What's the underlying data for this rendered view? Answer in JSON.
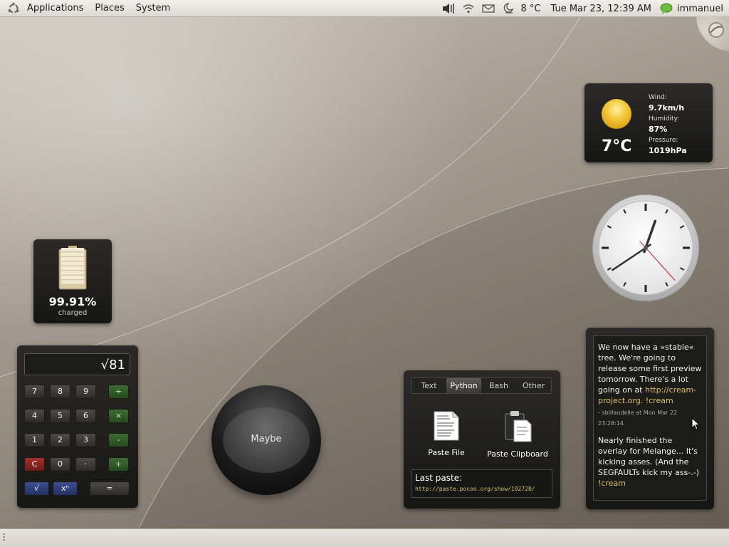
{
  "top_panel": {
    "menus": [
      "Applications",
      "Places",
      "System"
    ],
    "weather_text": "8 °C",
    "datetime": "Tue Mar 23, 12:39 AM",
    "username": "immanuel",
    "icons": [
      "ubuntu-logo-icon",
      "volume-icon",
      "wifi-icon",
      "mail-icon",
      "weather-night-icon",
      "chat-status-icon"
    ]
  },
  "weather": {
    "temperature": "7°C",
    "wind_label": "Wind:",
    "wind_value": "9.7km/h",
    "humidity_label": "Humidity:",
    "humidity_value": "87%",
    "pressure_label": "Pressure:",
    "pressure_value": "1019hPa",
    "condition_icon": "sun-icon"
  },
  "clock": {
    "hour": 12,
    "minute": 39,
    "second": 23
  },
  "battery": {
    "percent_text": "99.91%",
    "status": "charged",
    "level": 0.9991
  },
  "calculator": {
    "display": "√81",
    "keys": {
      "k7": "7",
      "k8": "8",
      "k9": "9",
      "div": "÷",
      "k4": "4",
      "k5": "5",
      "k6": "6",
      "mul": "×",
      "k1": "1",
      "k2": "2",
      "k3": "3",
      "sub": "-",
      "clear": "C",
      "k0": "0",
      "dot": "·",
      "add": "+",
      "sqrt": "√",
      "pow": "xⁿ",
      "eq": "="
    }
  },
  "eightball": {
    "answer": "Maybe"
  },
  "pastebin": {
    "tabs": [
      "Text",
      "Python",
      "Bash",
      "Other"
    ],
    "active_tab": "Python",
    "paste_file": "Paste File",
    "paste_clipboard": "Paste Clipboard",
    "last_paste_label": "Last paste:",
    "last_paste_url": "http://paste.pocoo.org/show/192720/"
  },
  "microblog": {
    "post1": {
      "text": "We now have a »stable« tree. We're going to release some first preview tomorrow. There's a lot going on at ",
      "link": "http://cream-project.org.",
      "tag": " !cream",
      "meta": "- sbillaudelle at Mon Mar 22 23:28:14"
    },
    "post2": {
      "text": "Nearly finished the overlay for Melange... It's kicking asses. (And the SEGFAULTs kick my ass-.-) ",
      "tag": "!cream"
    }
  }
}
